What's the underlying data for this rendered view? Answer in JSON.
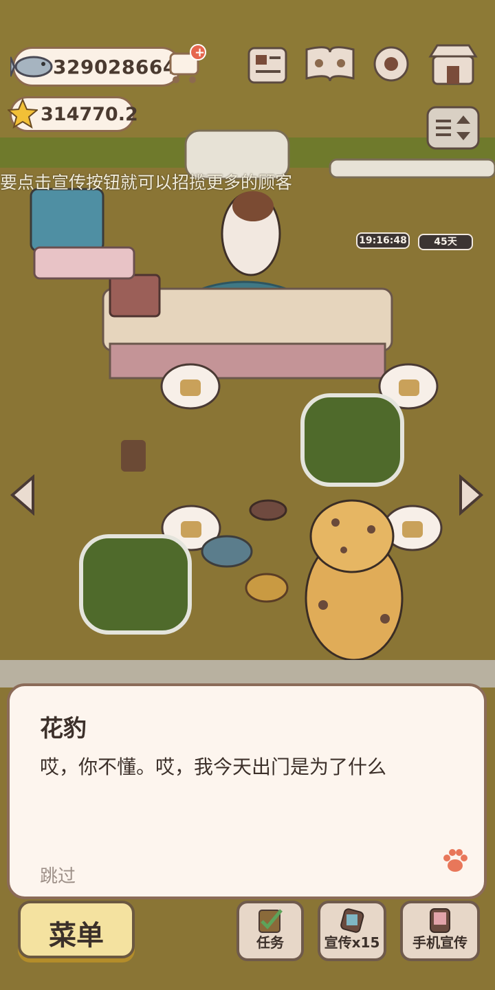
{
  "hud": {
    "fish_count": "329028664",
    "star_count": "314770.2"
  },
  "banner": {
    "scroll_text": "要点击宣传按钮就可以招揽更多的顾客"
  },
  "timers": {
    "countdown": "19:16:48",
    "days": "45天"
  },
  "dialog": {
    "speaker": "花豹",
    "text": "哎，你不懂。哎，我今天出门是为了什么",
    "skip_label": "跳过"
  },
  "bottom_bar": {
    "menu_label": "菜单",
    "task_label": "任务",
    "promote_label": "宣传x15",
    "phone_promote_label": "手机宣传"
  },
  "colors": {
    "ground": "#8a7535",
    "dialog_bg": "#fdf5ee",
    "dialog_border": "#8b6b58",
    "accent_paw": "#e8775a"
  },
  "icons": [
    "fish-icon",
    "cart-plus-icon",
    "star-icon",
    "newspaper-icon",
    "book-paw-icon",
    "gear-icon",
    "shop-icon",
    "sort-icon",
    "left-arrow-icon",
    "right-arrow-icon",
    "paw-icon",
    "task-check-icon",
    "promote-icon",
    "phone-promote-icon"
  ]
}
